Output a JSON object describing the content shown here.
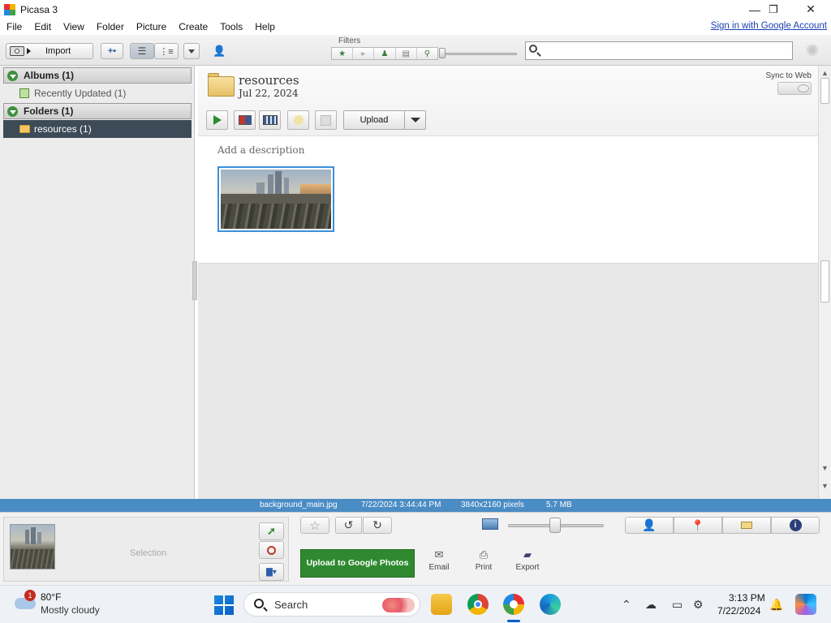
{
  "window": {
    "title": "Picasa 3",
    "controls": {
      "minimize": "—",
      "maximize": "❐",
      "close": "✕"
    }
  },
  "menu": {
    "items": [
      "File",
      "Edit",
      "View",
      "Folder",
      "Picture",
      "Create",
      "Tools",
      "Help"
    ],
    "signin": "Sign in with Google Account"
  },
  "toolbar": {
    "import_label": "Import",
    "filters_label": "Filters",
    "search_value": "",
    "search_placeholder": ""
  },
  "library": {
    "albums_header": "Albums (1)",
    "albums_items": [
      "Recently Updated (1)"
    ],
    "folders_header": "Folders (1)",
    "folders_items": [
      "resources (1)"
    ],
    "selected_folder": "resources (1)"
  },
  "folder": {
    "name": "resources",
    "date": "Jul 22, 2024",
    "sync_label": "Sync to Web",
    "upload_label": "Upload",
    "description_placeholder": "Add a description"
  },
  "photo_info": {
    "filename": "background_main.jpg",
    "datetime": "7/22/2024 3:44:44 PM",
    "dimensions": "3840x2160 pixels",
    "size": "5.7 MB"
  },
  "tray": {
    "selection_label": "Selection",
    "upload_google_photos": "Upload to Google Photos",
    "actions": [
      "Email",
      "Print",
      "Export"
    ]
  },
  "taskbar": {
    "weather_temp": "80°F",
    "weather_desc": "Mostly cloudy",
    "weather_badge": "1",
    "search_label": "Search",
    "time": "3:13 PM",
    "date": "7/22/2024"
  },
  "colors": {
    "status_strip": "#4a8cc4",
    "selected_folder_bg": "#3d4a57",
    "upload_green": "#2f8a2f",
    "thumb_border": "#3a8fdc",
    "link_blue": "#1a3fb0"
  }
}
